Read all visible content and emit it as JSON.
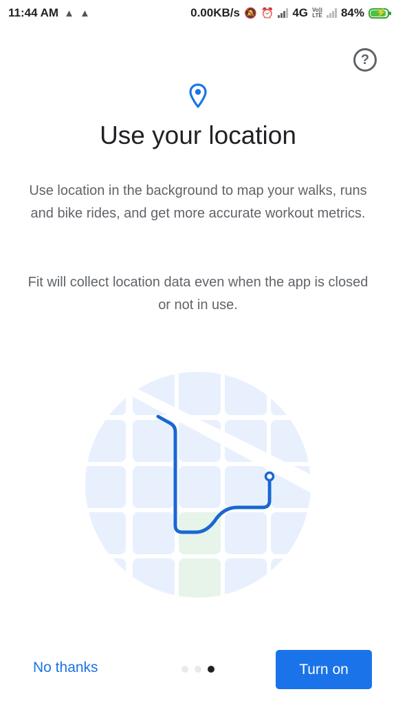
{
  "status_bar": {
    "time": "11:44 AM",
    "warning_icons": [
      "warning-icon",
      "warning-icon"
    ],
    "network_speed": "0.00KB/s",
    "network_type": "4G",
    "volte_top": "Vo))",
    "volte_bottom": "LTE",
    "battery_percent": "84%",
    "battery_level": 0.84,
    "battery_color": "#4cc13f"
  },
  "header": {
    "help_icon_glyph": "?"
  },
  "main": {
    "title": "Use your location",
    "description_1": "Use location in the background to map your walks, runs and bike rides, and get more accurate workout metrics.",
    "description_2": "Fit will collect location data even when the app is closed or not in use."
  },
  "footer": {
    "secondary_button": "No thanks",
    "primary_button": "Turn on",
    "page_count": 3,
    "current_page": 3
  },
  "colors": {
    "accent": "#1a73e8",
    "route": "#1967d2",
    "map_block": "#e8f0fe",
    "park_block": "#e6f4ea",
    "title": "#202124",
    "body": "#5f6368"
  }
}
